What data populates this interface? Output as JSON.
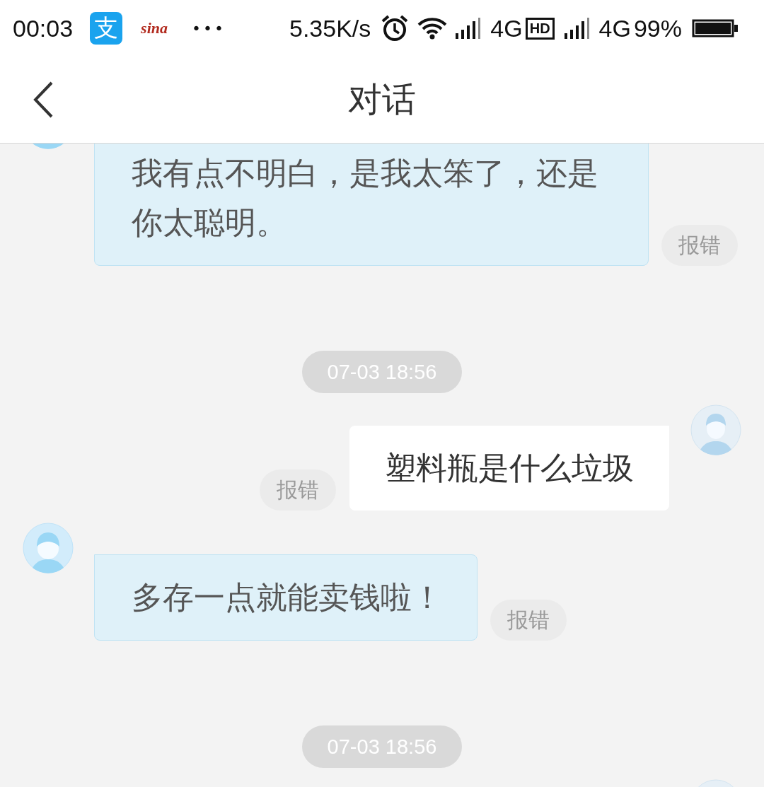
{
  "status_bar": {
    "time": "00:03",
    "notifications": [
      {
        "kind": "alipay",
        "glyph": "支"
      },
      {
        "kind": "sina",
        "glyph": "sina"
      }
    ],
    "more": "•••",
    "net_speed": "5.35K/s",
    "network_1": "4G",
    "hd": "HD",
    "network_2": "4G",
    "battery": "99%"
  },
  "header": {
    "title": "对话"
  },
  "messages": [
    {
      "kind": "received",
      "text": "我有点不明白，是我太笨了，还是你太聪明。",
      "report": "报错"
    },
    {
      "kind": "timestamp",
      "text": "07-03 18:56"
    },
    {
      "kind": "sent",
      "text": "塑料瓶是什么垃圾",
      "report": "报错"
    },
    {
      "kind": "received",
      "text": "多存一点就能卖钱啦！",
      "report": "报错"
    },
    {
      "kind": "timestamp",
      "text": "07-03 18:56"
    },
    {
      "kind": "sent"
    }
  ]
}
